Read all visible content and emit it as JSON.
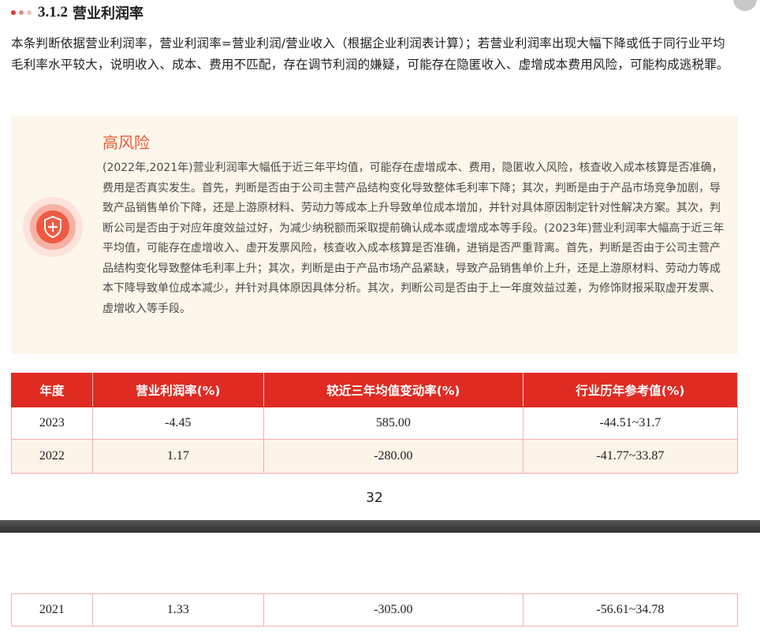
{
  "section": {
    "number": "3.1.2",
    "title": "营业利润率"
  },
  "intro": "本条判断依据营业利润率，营业利润率=营业利润/营业收入（根据企业利润表计算）；若营业利润率出现大幅下降或低于同行业平均毛利率水平较大，说明收入、成本、费用不匹配，存在调节利润的嫌疑，可能存在隐匿收入、虚增成本费用风险，可能构成逃税罪。",
  "risk": {
    "level": "高风险",
    "icon": "shield-plus-icon",
    "text": "(2022年,2021年)营业利润率大幅低于近三年平均值，可能存在虚增成本、费用，隐匿收入风险，核查收入成本核算是否准确，费用是否真实发生。首先，判断是否由于公司主营产品结构变化导致整体毛利率下降；其次，判断是由于产品市场竞争加剧，导致产品销售单价下降，还是上游原材料、劳动力等成本上升导致单位成本增加，并针对具体原因制定针对性解决方案。其次，判断公司是否由于对应年度效益过好，为减少纳税额而采取提前确认成本或虚增成本等手段。(2023年)营业利润率大幅高于近三年平均值，可能存在虚增收入、虚开发票风险，核查收入成本核算是否准确，进销是否严重背离。首先，判断是否由于公司主营产品结构变化导致整体毛利率上升；其次，判断是由于产品市场产品紧缺，导致产品销售单价上升，还是上游原材料、劳动力等成本下降导致单位成本减少，并针对具体原因具体分析。其次，判断公司是否由于上一年度效益过差，为修饰财报采取虚开发票、虚增收入等手段。"
  },
  "table": {
    "headers": [
      "年度",
      "营业利润率(%)",
      "较近三年均值变动率(%)",
      "行业历年参考值(%)"
    ],
    "rows": [
      [
        "2023",
        "-4.45",
        "585.00",
        "-44.51~31.7"
      ],
      [
        "2022",
        "1.17",
        "-280.00",
        "-41.77~33.87"
      ],
      [
        "2021",
        "1.33",
        "-305.00",
        "-56.61~34.78"
      ]
    ]
  },
  "page_number": "32",
  "colors": {
    "accent_red": "#e02b22",
    "risk_title": "#e95d3a",
    "risk_bg": "#fdf6ea"
  }
}
